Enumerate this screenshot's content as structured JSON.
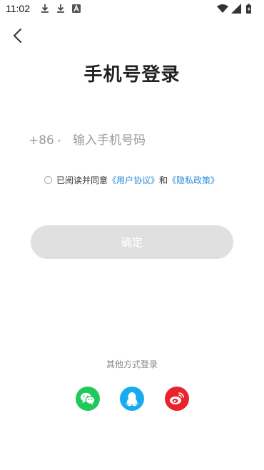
{
  "status_bar": {
    "time": "11:02",
    "icons": [
      "download-icon",
      "download-icon",
      "a-box-icon",
      "wifi-icon",
      "signal-icon",
      "battery-icon"
    ]
  },
  "header": {
    "back_icon": "chevron-left-icon",
    "title": "手机号登录"
  },
  "phone": {
    "country_code": "+86",
    "caret": "▾",
    "placeholder": "输入手机号码"
  },
  "agreement": {
    "prefix": "已阅读并同意",
    "user_agreement": "《用户协议》",
    "and": "和",
    "privacy_policy": "《隐私政策》",
    "link_color": "#2b8cd6"
  },
  "confirm_button": {
    "label": "确定",
    "bg_color": "#e0e0e0"
  },
  "other_login": {
    "label": "其他方式登录",
    "providers": [
      {
        "name": "wechat",
        "icon": "wechat-icon",
        "color": "#1fca5b"
      },
      {
        "name": "qq",
        "icon": "qq-icon",
        "color": "#1aabef"
      },
      {
        "name": "weibo",
        "icon": "weibo-icon",
        "color": "#e8232c"
      }
    ]
  }
}
